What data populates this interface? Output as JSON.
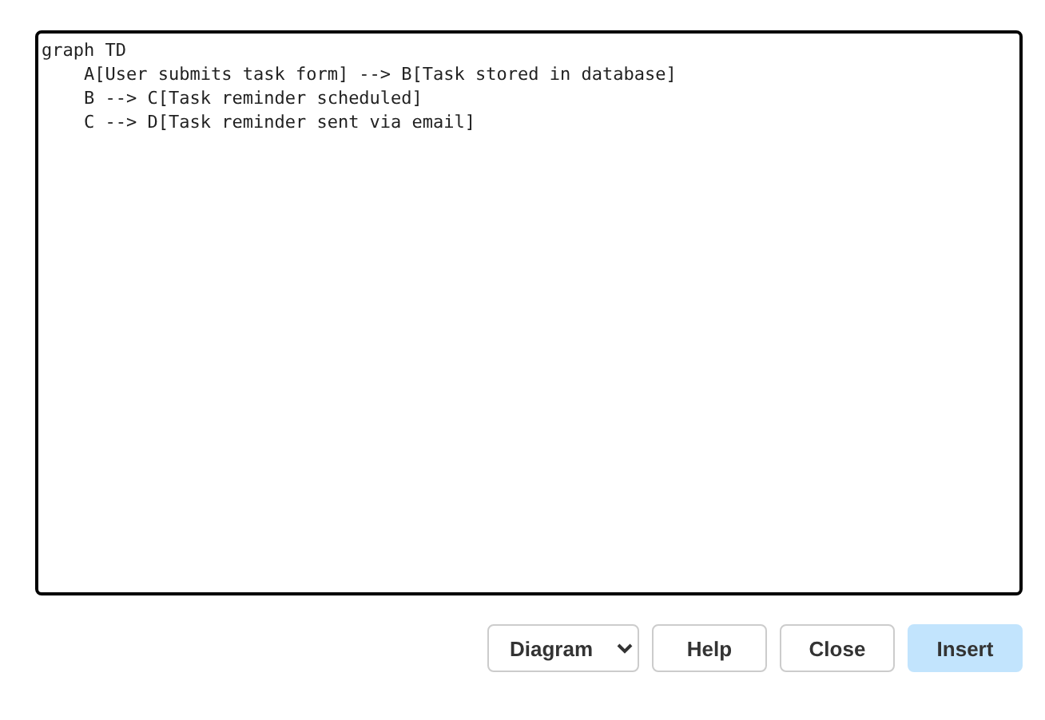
{
  "editor": {
    "value": "graph TD\n    A[User submits task form] --> B[Task stored in database]\n    B --> C[Task reminder scheduled]\n    C --> D[Task reminder sent via email]"
  },
  "format_select": {
    "value": "Diagram"
  },
  "buttons": [
    {
      "label": "Help",
      "kind": "default"
    },
    {
      "label": "Close",
      "kind": "default"
    },
    {
      "label": "Insert",
      "kind": "primary"
    }
  ]
}
